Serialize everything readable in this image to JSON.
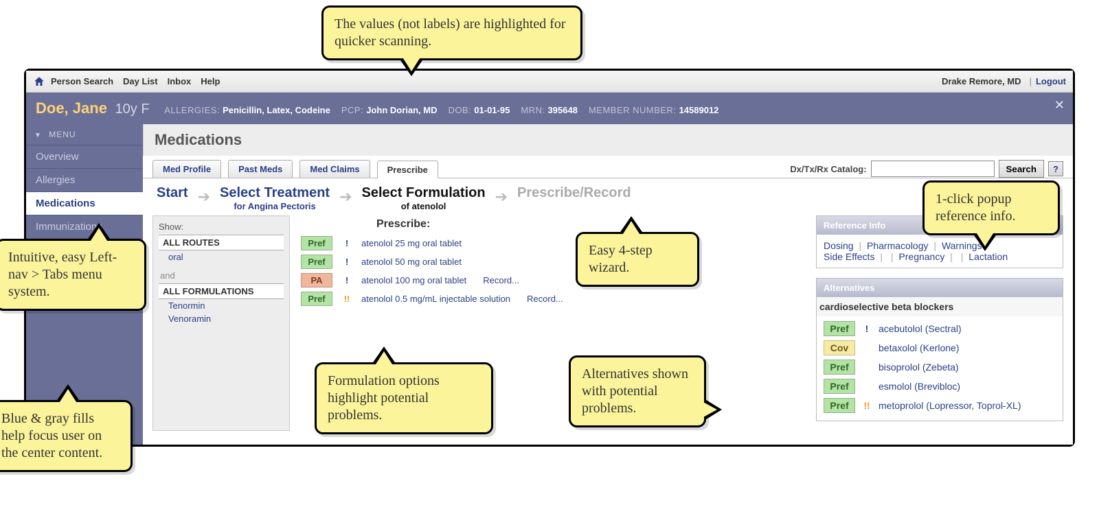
{
  "menubar": {
    "items": [
      "Person Search",
      "Day List",
      "Inbox",
      "Help"
    ],
    "user": "Drake Remore, MD",
    "logout": "Logout"
  },
  "patient": {
    "name": "Doe, Jane",
    "age_sex": "10y F",
    "fields": [
      {
        "label": "ALLERGIES:",
        "value": "Penicillin, Latex, Codeine"
      },
      {
        "label": "PCP:",
        "value": "John Dorian, MD"
      },
      {
        "label": "DOB:",
        "value": "01-01-95"
      },
      {
        "label": "MRN:",
        "value": "395648"
      },
      {
        "label": "MEMBER NUMBER:",
        "value": "14589012"
      }
    ]
  },
  "leftnav": {
    "header": "MENU",
    "items": [
      "Overview",
      "Allergies",
      "Medications",
      "Immunizations"
    ],
    "active_index": 2
  },
  "page_title": "Medications",
  "tabs": {
    "items": [
      "Med Profile",
      "Past Meds",
      "Med Claims",
      "Prescribe"
    ],
    "active_index": 3,
    "search_label": "Dx/Tx/Rx Catalog:",
    "search_button": "Search"
  },
  "wizard": {
    "steps": [
      {
        "top": "Start",
        "sub": "",
        "color": "blue"
      },
      {
        "top": "Select Treatment",
        "sub": "for Angina Pectoris",
        "color": "blue"
      },
      {
        "top": "Select Formulation",
        "sub": "of atenolol",
        "color": "black"
      },
      {
        "top": "Prescribe/Record",
        "sub": "",
        "color": "gray"
      }
    ]
  },
  "filters": {
    "show_label": "Show:",
    "routes_header": "ALL ROUTES",
    "routes": [
      "oral"
    ],
    "and": "and",
    "form_header": "ALL FORMULATIONS",
    "formulations": [
      "Tenormin",
      "Venoramin"
    ]
  },
  "rxlist": {
    "header": "Prescribe:",
    "rows": [
      {
        "badge": "Pref",
        "badge_cls": "b-pref",
        "exc": "!",
        "exc_cls": "blue",
        "name": "atenolol 25 mg oral tablet",
        "record": ""
      },
      {
        "badge": "Pref",
        "badge_cls": "b-pref",
        "exc": "!",
        "exc_cls": "blue",
        "name": "atenolol 50 mg oral tablet",
        "record": ""
      },
      {
        "badge": "PA",
        "badge_cls": "b-pa",
        "exc": "!",
        "exc_cls": "blue",
        "name": "atenolol 100 mg oral tablet",
        "record": "Record..."
      },
      {
        "badge": "Pref",
        "badge_cls": "b-pref",
        "exc": "!!",
        "exc_cls": "orange",
        "name": "atenolol 0.5 mg/mL injectable solution",
        "record": "Record..."
      }
    ]
  },
  "reference": {
    "title": "Reference Info",
    "links": [
      "Dosing",
      "Pharmacology",
      "Warnings",
      "Side Effects",
      "Pregnancy",
      "Lactation"
    ]
  },
  "alternatives": {
    "title": "Alternatives",
    "group": "cardioselective beta blockers",
    "rows": [
      {
        "badge": "Pref",
        "badge_cls": "b-pref",
        "exc": "!",
        "exc_cls": "blue",
        "name": "acebutolol (Sectral)"
      },
      {
        "badge": "Cov",
        "badge_cls": "b-cov",
        "exc": "",
        "exc_cls": "",
        "name": "betaxolol (Kerlone)"
      },
      {
        "badge": "Pref",
        "badge_cls": "b-pref",
        "exc": "",
        "exc_cls": "",
        "name": "bisoprolol (Zebeta)"
      },
      {
        "badge": "Pref",
        "badge_cls": "b-pref",
        "exc": "",
        "exc_cls": "",
        "name": "esmolol (Brevibloc)"
      },
      {
        "badge": "Pref",
        "badge_cls": "b-pref",
        "exc": "!!",
        "exc_cls": "orange",
        "name": "metoprolol (Lopressor, Toprol-XL)"
      }
    ]
  },
  "callouts": {
    "c1": "The values (not labels) are highlighted for quicker scanning.",
    "c2": "Intuitive, easy Left-nav > Tabs menu system.",
    "c3": "Blue & gray fills help focus user on the center content.",
    "c4": "Easy 4-step wizard.",
    "c5": "Formulation options highlight potential problems.",
    "c6": "Alternatives shown with potential problems.",
    "c7": "1-click popup reference info."
  }
}
